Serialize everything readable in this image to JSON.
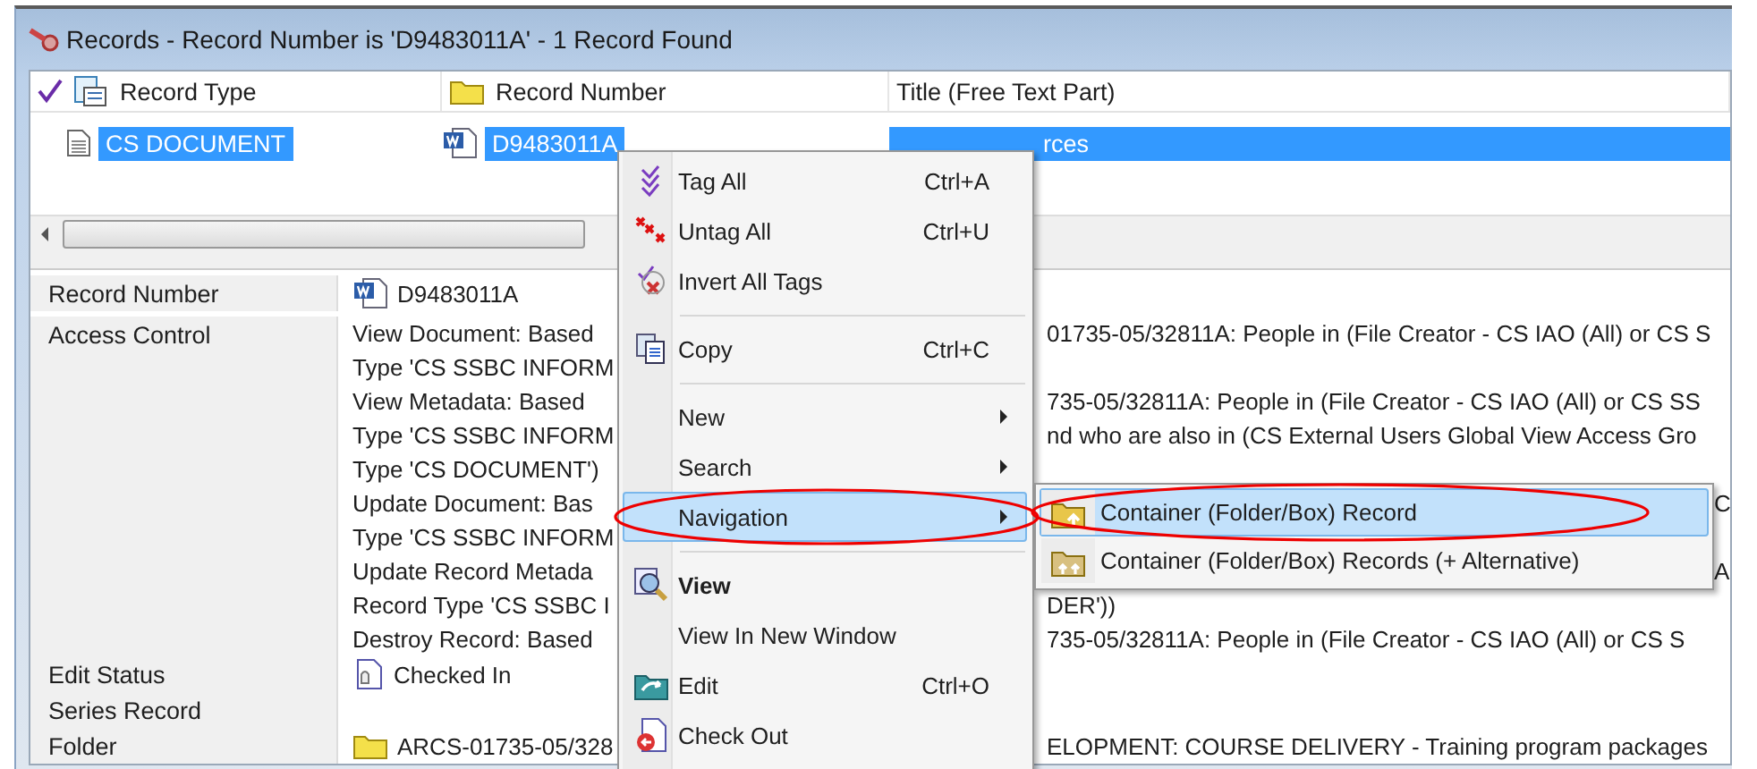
{
  "window": {
    "title": "Records - Record Number is 'D9483011A' - 1 Record Found"
  },
  "list": {
    "columns": [
      {
        "label": "Record Type",
        "tagged": true
      },
      {
        "label": "Record Number"
      },
      {
        "label": "Title (Free Text Part)"
      }
    ],
    "rows": [
      {
        "selected": true,
        "record_type": "CS DOCUMENT",
        "record_number": "D9483011A",
        "title": "rces"
      }
    ]
  },
  "details": [
    {
      "label": "Record Number",
      "lines": [
        {
          "left": "D9483011A"
        }
      ]
    },
    {
      "label": "Access Control",
      "lines": [
        {
          "left": "View Document: Based",
          "right": "01735-05/32811A: People in (File Creator - CS IAO (All) or CS S"
        },
        {
          "left": "Type 'CS SSBC INFORM"
        },
        {
          "left": "View Metadata: Based",
          "right": "735-05/32811A: People in (File Creator - CS IAO (All) or CS SS"
        },
        {
          "left": "Type 'CS SSBC INFORM",
          "right": "nd who are also in (CS External Users Global View Access Gro"
        },
        {
          "left": "Type 'CS DOCUMENT')"
        },
        {
          "left": "Update Document: Bas",
          "far": "C"
        },
        {
          "left": "Type 'CS SSBC INFORM"
        },
        {
          "left": "Update Record Metada",
          "far": "A"
        },
        {
          "left": "Record Type 'CS SSBC I",
          "right": "DER'))"
        },
        {
          "left": "Destroy Record: Based",
          "right": "735-05/32811A: People in (File Creator - CS IAO (All) or CS S"
        }
      ]
    },
    {
      "label": "Edit Status",
      "lines": [
        {
          "left": "Checked In"
        }
      ]
    },
    {
      "label": "Series Record"
    },
    {
      "label": "Folder",
      "lines": [
        {
          "left": "ARCS-01735-05/328",
          "right": "ELOPMENT: COURSE DELIVERY - Training program packages"
        }
      ]
    }
  ],
  "context_menu": {
    "items": [
      {
        "kind": "item",
        "label": "Tag All",
        "shortcut": "Ctrl+A",
        "selected": false,
        "circled": false
      },
      {
        "kind": "item",
        "label": "Untag All",
        "shortcut": "Ctrl+U",
        "selected": false,
        "circled": false
      },
      {
        "kind": "item",
        "label": "Invert All Tags",
        "selected": false,
        "circled": false
      },
      {
        "kind": "separator"
      },
      {
        "kind": "item",
        "label": "Copy",
        "shortcut": "Ctrl+C",
        "selected": false,
        "circled": false
      },
      {
        "kind": "separator"
      },
      {
        "kind": "submenu",
        "label": "New",
        "selected": false,
        "circled": false
      },
      {
        "kind": "submenu",
        "label": "Search",
        "selected": false,
        "circled": false
      },
      {
        "kind": "submenu",
        "label": "Navigation",
        "selected": true,
        "circled": true
      },
      {
        "kind": "separator"
      },
      {
        "kind": "default",
        "label": "View",
        "selected": false,
        "circled": false
      },
      {
        "kind": "item",
        "label": "View In New Window",
        "selected": false,
        "circled": false
      },
      {
        "kind": "item",
        "label": "Edit",
        "shortcut": "Ctrl+O",
        "selected": false,
        "circled": false
      },
      {
        "kind": "item",
        "label": "Check Out",
        "selected": false,
        "circled": false
      }
    ]
  },
  "submenu": {
    "items": [
      {
        "label": "Container (Folder/Box) Record",
        "selected": true,
        "circled": true
      },
      {
        "label": "Container (Folder/Box) Records (+ Alternative)",
        "selected": false,
        "circled": false
      }
    ]
  }
}
